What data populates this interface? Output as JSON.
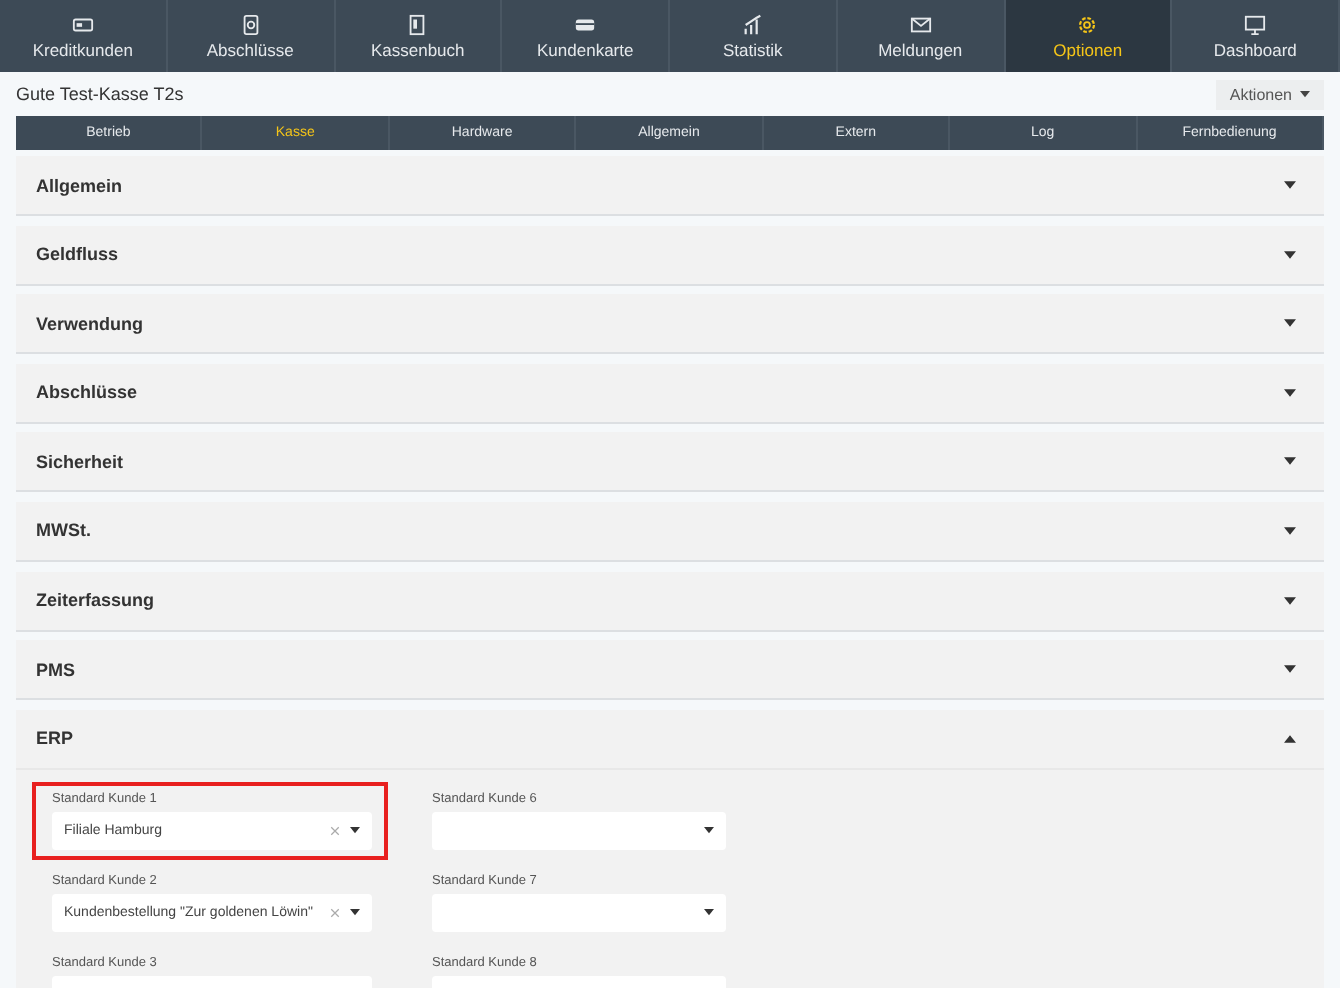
{
  "nav": [
    {
      "label": "Kreditkunden",
      "selected": false
    },
    {
      "label": "Abschlüsse",
      "selected": false
    },
    {
      "label": "Kassenbuch",
      "selected": false
    },
    {
      "label": "Kundenkarte",
      "selected": false
    },
    {
      "label": "Statistik",
      "selected": false
    },
    {
      "label": "Meldungen",
      "selected": false
    },
    {
      "label": "Optionen",
      "selected": true
    },
    {
      "label": "Dashboard",
      "selected": false
    }
  ],
  "page_title": "Gute Test-Kasse T2s",
  "actions_button": "Aktionen",
  "tabs": [
    {
      "label": "Betrieb",
      "selected": false
    },
    {
      "label": "Kasse",
      "selected": true
    },
    {
      "label": "Hardware",
      "selected": false
    },
    {
      "label": "Allgemein",
      "selected": false
    },
    {
      "label": "Extern",
      "selected": false
    },
    {
      "label": "Log",
      "selected": false
    },
    {
      "label": "Fernbedienung",
      "selected": false
    }
  ],
  "sections": [
    {
      "title": "Allgemein",
      "expanded": false
    },
    {
      "title": "Geldfluss",
      "expanded": false
    },
    {
      "title": "Verwendung",
      "expanded": false
    },
    {
      "title": "Abschlüsse",
      "expanded": false
    },
    {
      "title": "Sicherheit",
      "expanded": false
    },
    {
      "title": "MWSt.",
      "expanded": false
    },
    {
      "title": "Zeiterfassung",
      "expanded": false
    },
    {
      "title": "PMS",
      "expanded": false
    },
    {
      "title": "ERP",
      "expanded": true
    }
  ],
  "erp_fields": [
    {
      "label": "Standard Kunde 1",
      "value": "Filiale Hamburg",
      "highlighted": true
    },
    {
      "label": "Standard Kunde 6",
      "highlighted": false
    },
    {
      "label": "Standard Kunde 2",
      "value": "Kundenbestellung \"Zur goldenen Löwin\"",
      "highlighted": false
    },
    {
      "label": "Standard Kunde 7",
      "highlighted": false
    },
    {
      "label": "Standard Kunde 3",
      "highlighted": false
    },
    {
      "label": "Standard Kunde 8",
      "highlighted": false
    }
  ]
}
